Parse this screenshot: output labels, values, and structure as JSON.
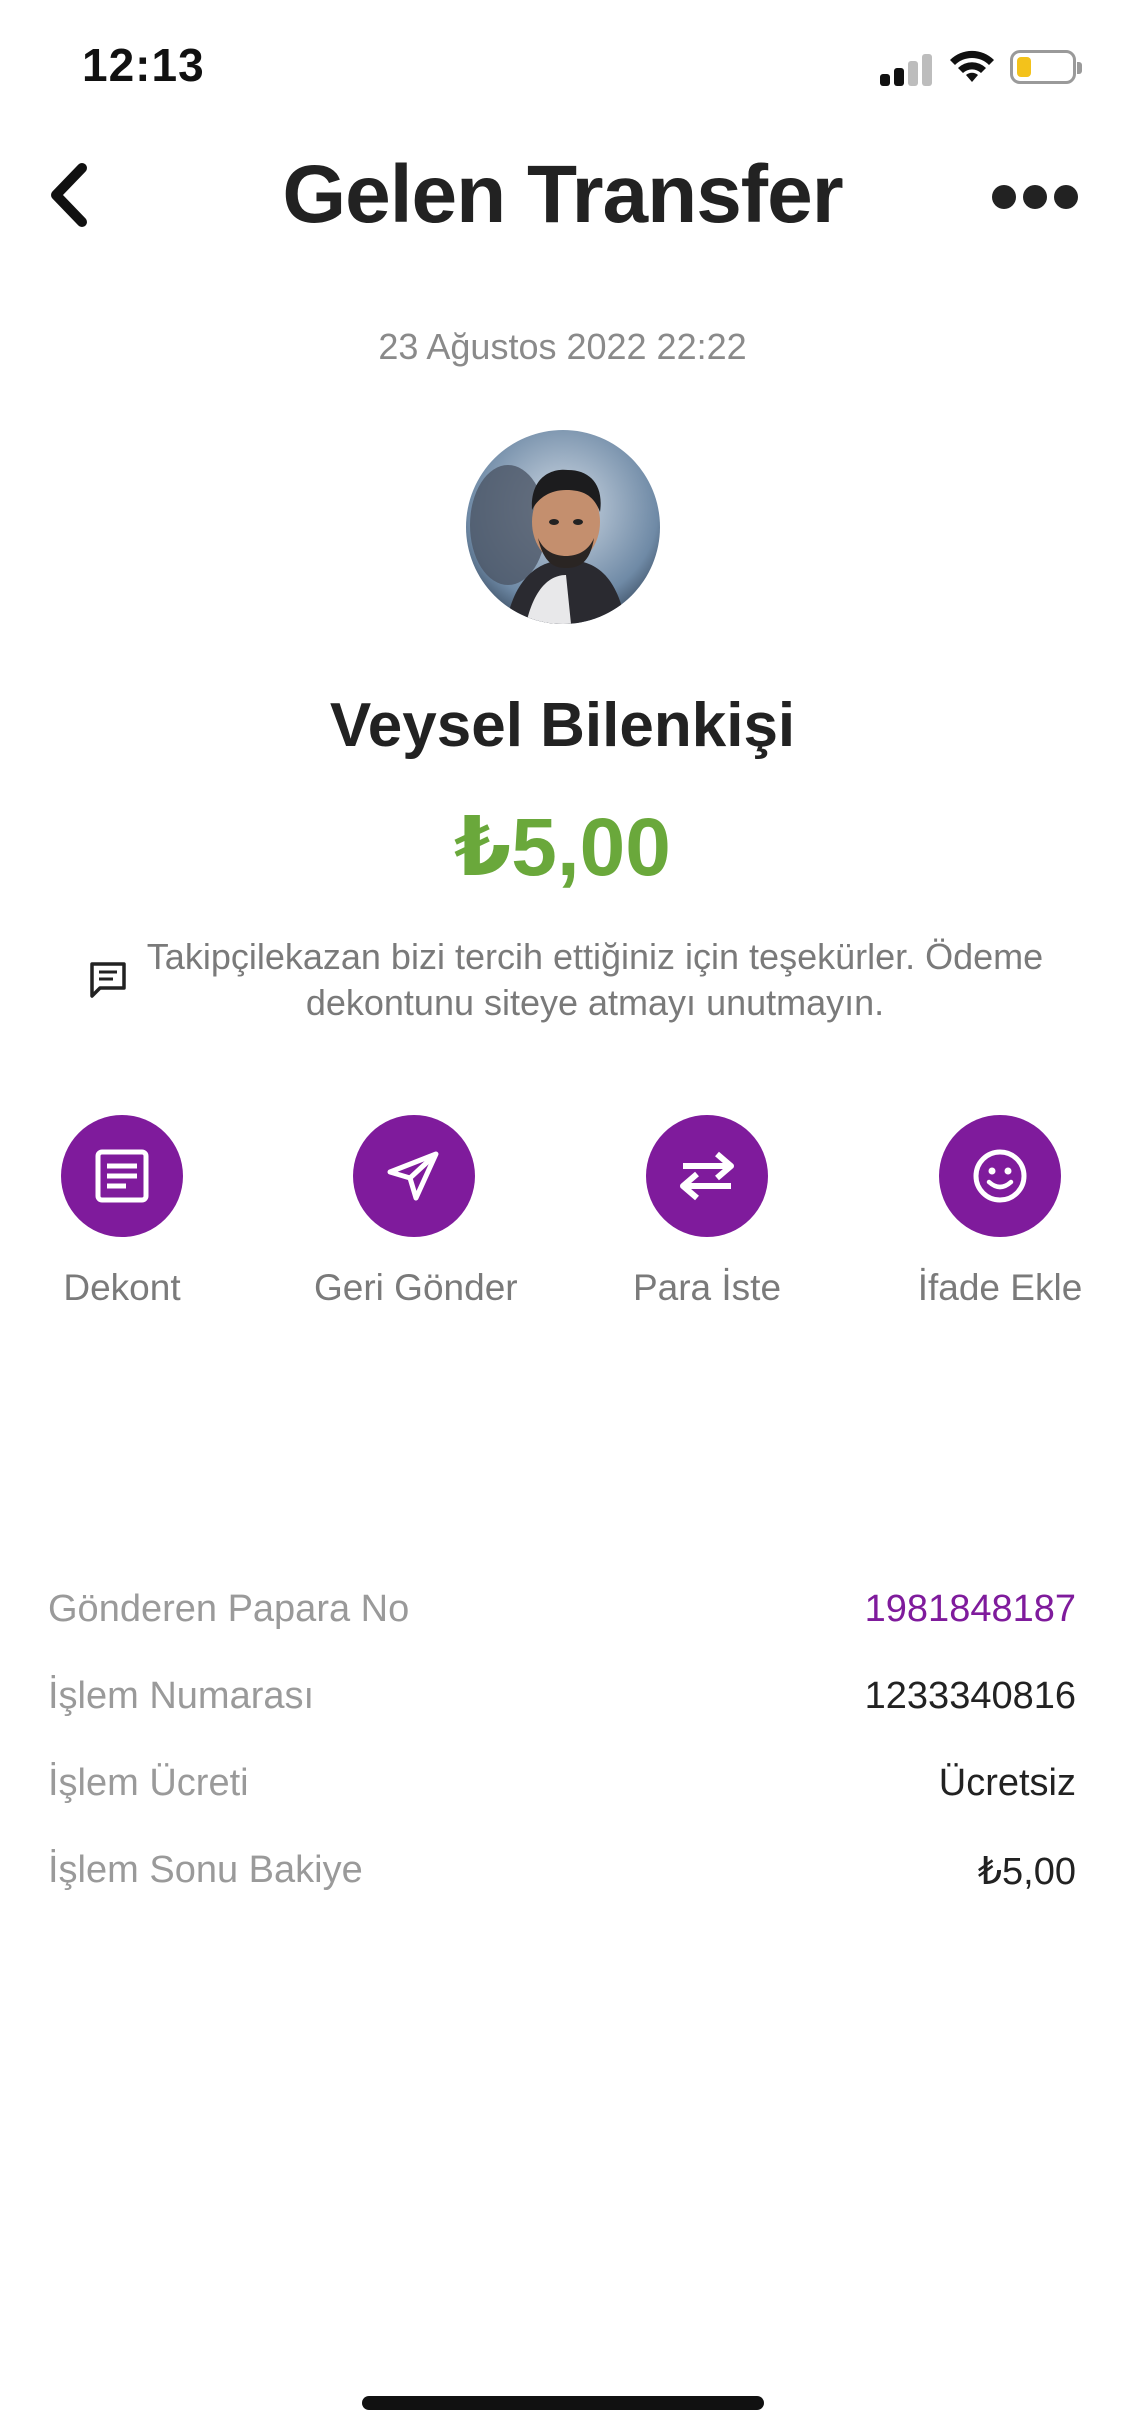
{
  "status_bar": {
    "time": "12:13",
    "battery_level": 0.25
  },
  "header": {
    "title": "Gelen Transfer"
  },
  "transaction": {
    "date": "23 Ağustos 2022 22:22",
    "sender_name": "Veysel Bilenkişi",
    "amount": "₺5,00",
    "message": "Takipçilekazan bizi tercih ettiğiniz için teşekürler. Ödeme dekontunu siteye atmayı unutmayın."
  },
  "actions": [
    {
      "label": "Dekont",
      "icon": "receipt-icon"
    },
    {
      "label": "Geri Gönder",
      "icon": "send-icon"
    },
    {
      "label": "Para İste",
      "icon": "exchange-icon"
    },
    {
      "label": "İfade Ekle",
      "icon": "smiley-icon"
    }
  ],
  "details": [
    {
      "label": "Gönderen Papara No",
      "value": "1981848187"
    },
    {
      "label": "İşlem Numarası",
      "value": "1233340816"
    },
    {
      "label": "İşlem Ücreti",
      "value": "Ücretsiz"
    },
    {
      "label": "İşlem Sonu Bakiye",
      "value": "₺5,00"
    }
  ],
  "colors": {
    "accent": "#7f1b9c",
    "amount": "#6aa83b",
    "link": "#7f1b9c"
  }
}
